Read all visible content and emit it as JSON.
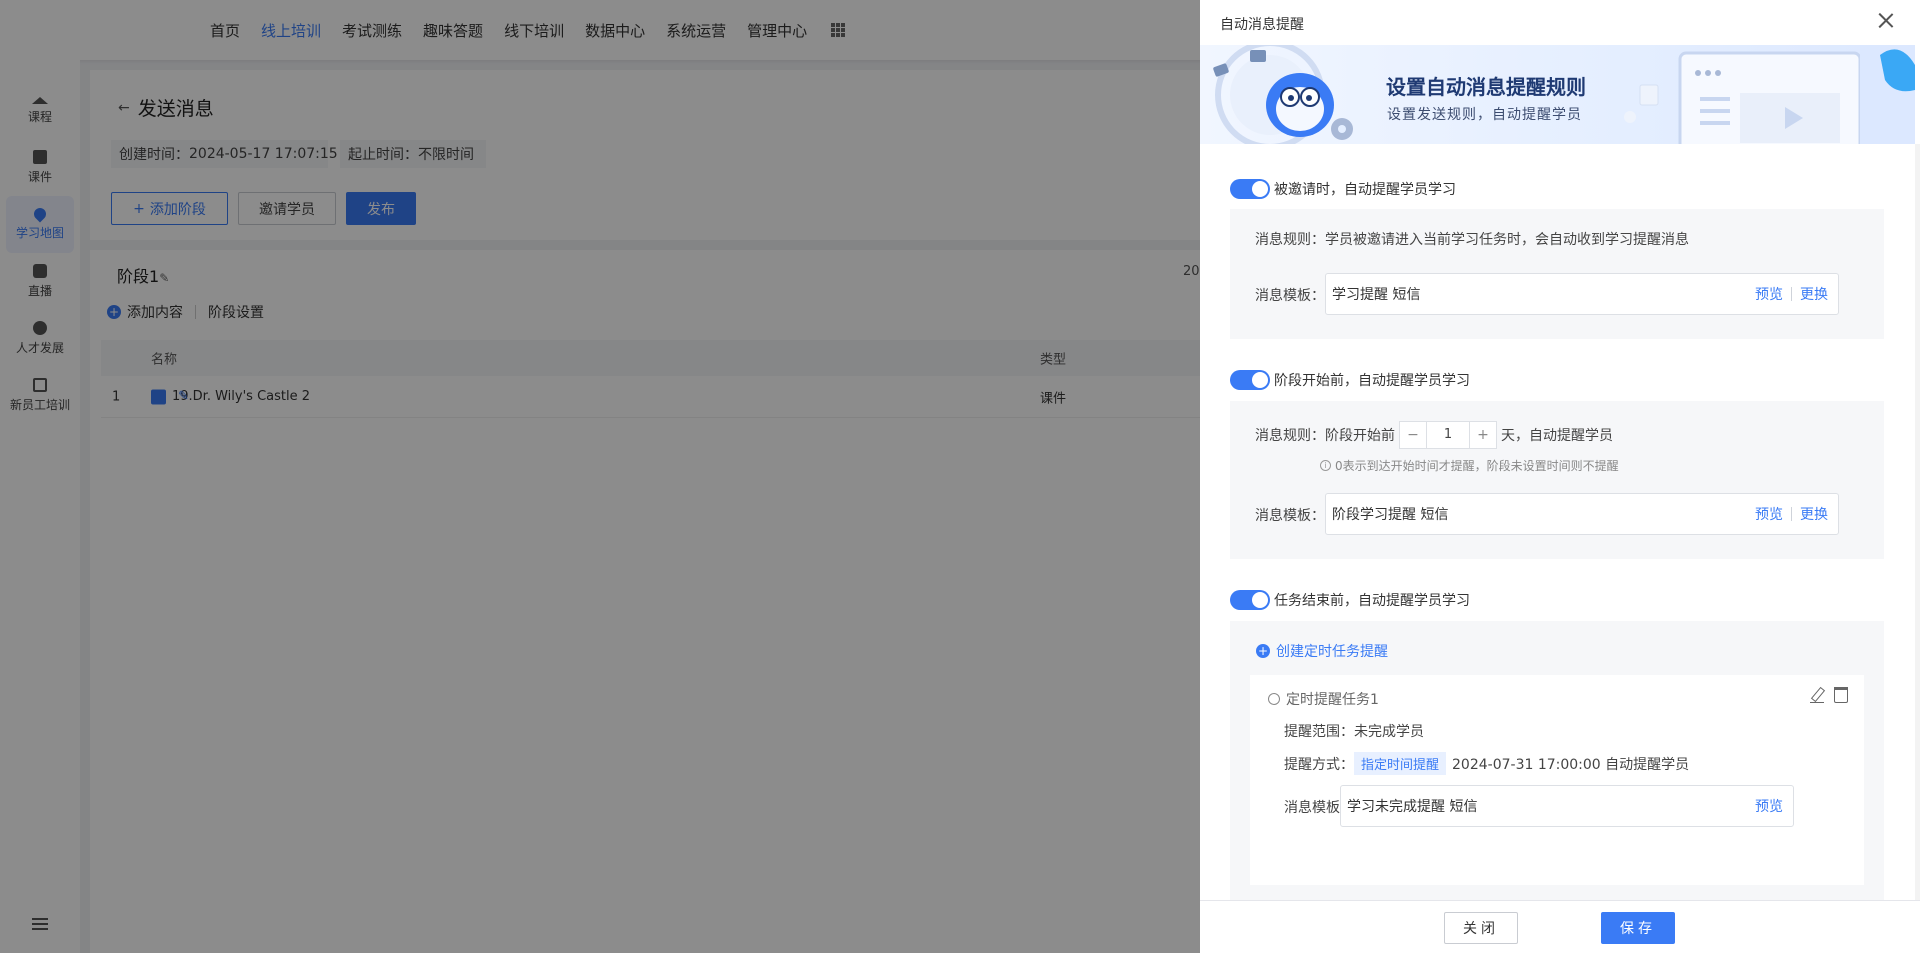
{
  "topnav": {
    "items": [
      "首页",
      "线上培训",
      "考试测练",
      "趣味答题",
      "线下培训",
      "数据中心",
      "系统运营",
      "管理中心"
    ],
    "active": "线上培训",
    "apps_icon": "grid-icon"
  },
  "sidebar": {
    "items": [
      {
        "label": "课程",
        "icon": "graduation-cap-icon"
      },
      {
        "label": "课件",
        "icon": "book-icon"
      },
      {
        "label": "学习地图",
        "icon": "map-pin-icon"
      },
      {
        "label": "直播",
        "icon": "live-icon"
      },
      {
        "label": "人才发展",
        "icon": "talent-icon"
      },
      {
        "label": "新员工培训",
        "icon": "edit-icon"
      }
    ],
    "active": "学习地图",
    "menu_icon": "menu-icon"
  },
  "page": {
    "back_icon": "←",
    "title": "发送消息",
    "created_label": "创建时间：",
    "created_value": "2024-05-17 17:07:15",
    "period_label": "起止时间：",
    "period_value": "不限时间",
    "add_stage": "添加阶段",
    "invite": "邀请学员",
    "publish": "发布"
  },
  "stage": {
    "title": "阶段1",
    "date_fragment": "20",
    "add_content": "添加内容",
    "settings": "阶段设置",
    "columns": {
      "name": "名称",
      "type": "类型"
    },
    "rows": [
      {
        "index": "1",
        "name": "19.Dr. Wily's Castle 2",
        "type": "课件"
      }
    ]
  },
  "drawer": {
    "title": "自动消息提醒",
    "banner": {
      "title": "设置自动消息提醒规则",
      "subtitle": "设置发送规则，自动提醒学员"
    },
    "section1": {
      "enabled": true,
      "title": "被邀请时，自动提醒学员学习",
      "rule_label": "消息规则：",
      "rule_text": "学员被邀请进入当前学习任务时，会自动收到学习提醒消息",
      "template_label": "消息模板：",
      "template_value": "学习提醒 短信",
      "preview": "预览",
      "replace": "更换"
    },
    "section2": {
      "enabled": true,
      "title": "阶段开始前，自动提醒学员学习",
      "rule_label": "消息规则：",
      "rule_prefix": "阶段开始前",
      "days_value": "1",
      "rule_suffix": "天，自动提醒学员",
      "minus": "−",
      "plus": "+",
      "hint": "0表示到达开始时间才提醒，阶段未设置时间则不提醒",
      "template_label": "消息模板：",
      "template_value": "阶段学习提醒 短信",
      "preview": "预览",
      "replace": "更换"
    },
    "section3": {
      "enabled": true,
      "title": "任务结束前，自动提醒学员学习",
      "create_link": "创建定时任务提醒",
      "task": {
        "title": "定时提醒任务1",
        "scope_label": "提醒范围：",
        "scope_value": "未完成学员",
        "method_label": "提醒方式：",
        "method_tag": "指定时间提醒",
        "method_value": "2024-07-31 17:00:00 自动提醒学员",
        "template_label": "消息模板：",
        "template_value": "学习未完成提醒 短信",
        "preview": "预览"
      }
    },
    "footer": {
      "cancel": "关闭",
      "save": "保存"
    }
  },
  "colors": {
    "accent": "#3a7bf5",
    "overlay": "rgba(0,0,0,0.45)",
    "panel_bg": "#f6f7f9"
  }
}
